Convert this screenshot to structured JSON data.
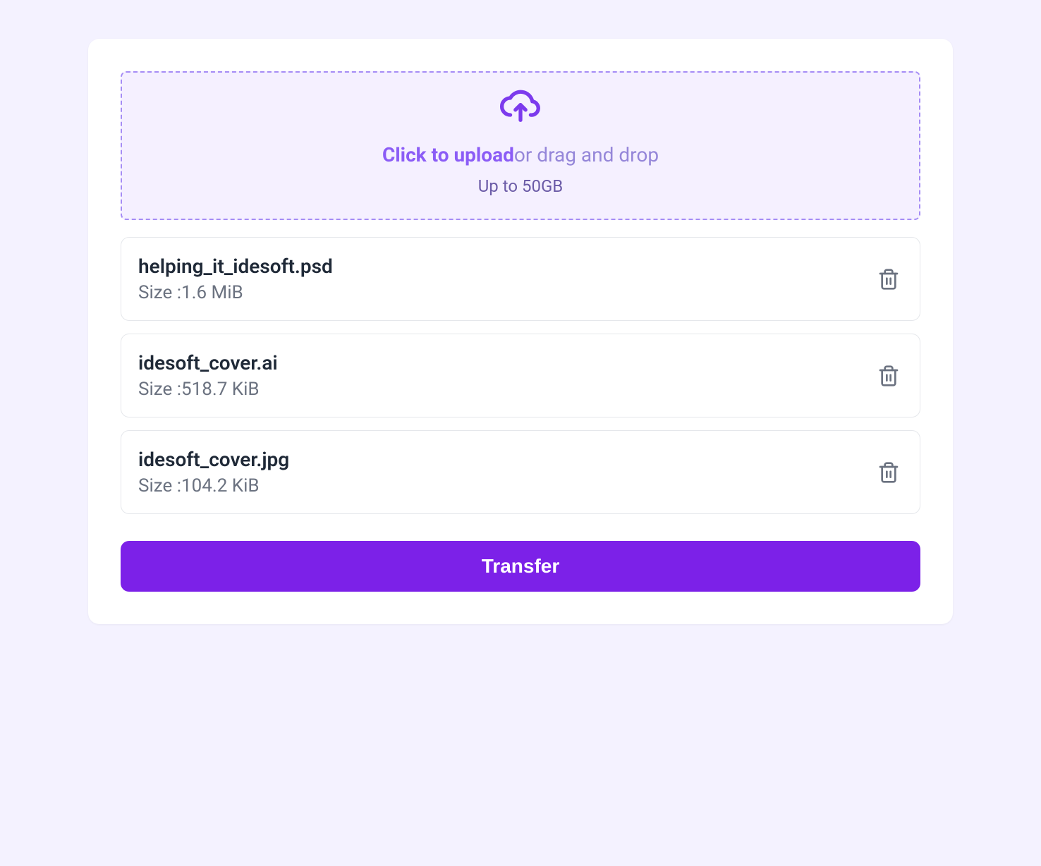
{
  "dropzone": {
    "upload_label_bold": "Click to upload",
    "upload_label_rest": "or drag and drop",
    "hint": "Up to 50GB"
  },
  "files": [
    {
      "name": "helping_it_idesoft.psd",
      "size_label": "Size :",
      "size": "1.6 MiB"
    },
    {
      "name": "idesoft_cover.ai",
      "size_label": "Size :",
      "size": "518.7 KiB"
    },
    {
      "name": "idesoft_cover.jpg",
      "size_label": "Size :",
      "size": "104.2 KiB"
    }
  ],
  "transfer_button_label": "Transfer"
}
